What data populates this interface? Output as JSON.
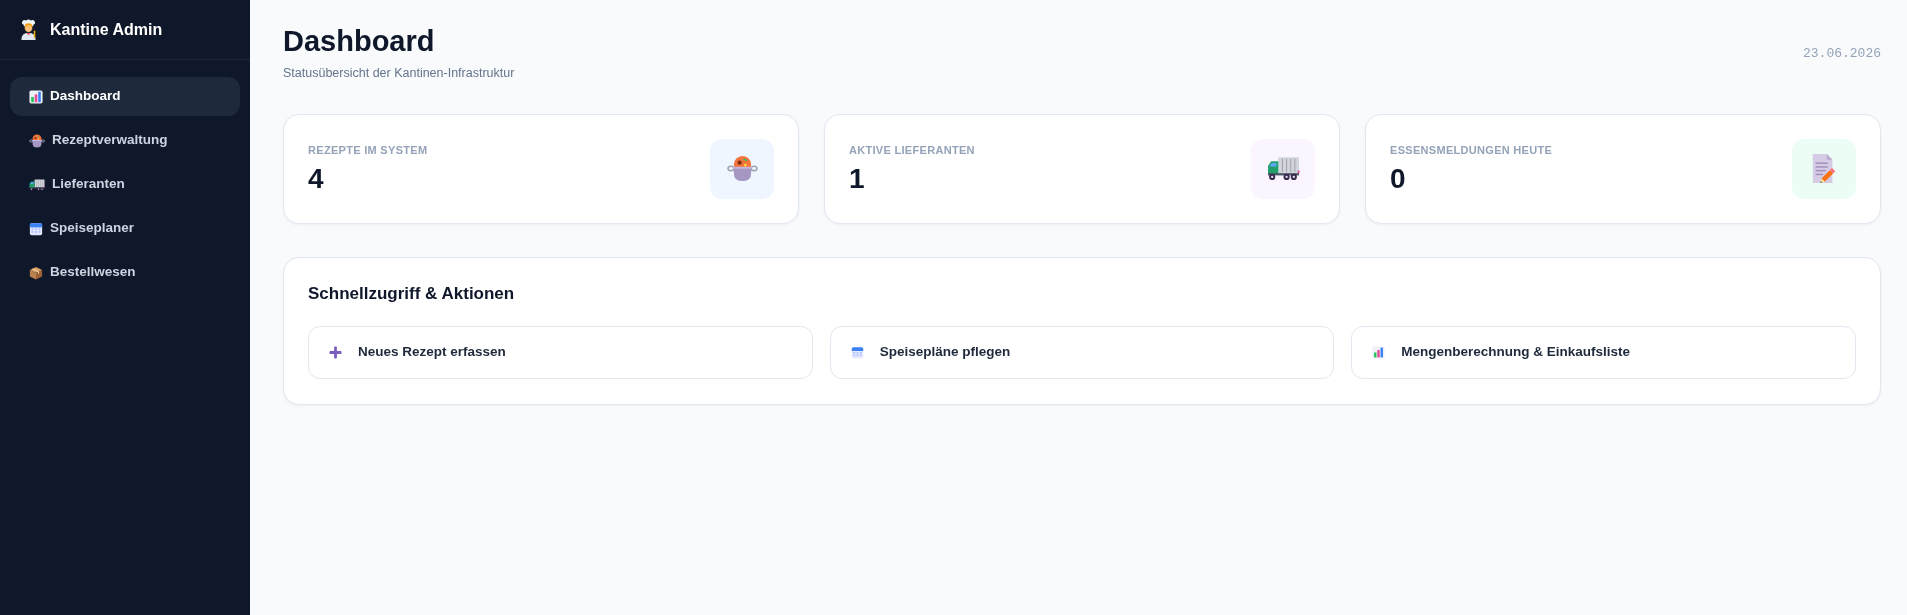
{
  "sidebar": {
    "brand": "Kantine Admin",
    "items": [
      {
        "label": "Dashboard",
        "selected": true
      },
      {
        "label": "Rezeptverwaltung",
        "selected": false
      },
      {
        "label": "Lieferanten",
        "selected": false
      },
      {
        "label": "Speiseplaner",
        "selected": false
      },
      {
        "label": "Bestellwesen",
        "selected": false
      }
    ]
  },
  "header": {
    "title": "Dashboard",
    "subtitle": "Statusübersicht der Kantinen-Infrastruktur",
    "date": "23.06.2026"
  },
  "stats": [
    {
      "label": "REZEPTE IM SYSTEM",
      "value": "4"
    },
    {
      "label": "AKTIVE LIEFERANTEN",
      "value": "1"
    },
    {
      "label": "ESSENSMELDUNGEN HEUTE",
      "value": "0"
    }
  ],
  "quick_actions": {
    "title": "Schnellzugriff & Aktionen",
    "buttons": [
      {
        "label": "Neues Rezept erfassen"
      },
      {
        "label": "Speisepläne pflegen"
      },
      {
        "label": "Mengenberechnung & Einkaufsliste"
      }
    ]
  }
}
